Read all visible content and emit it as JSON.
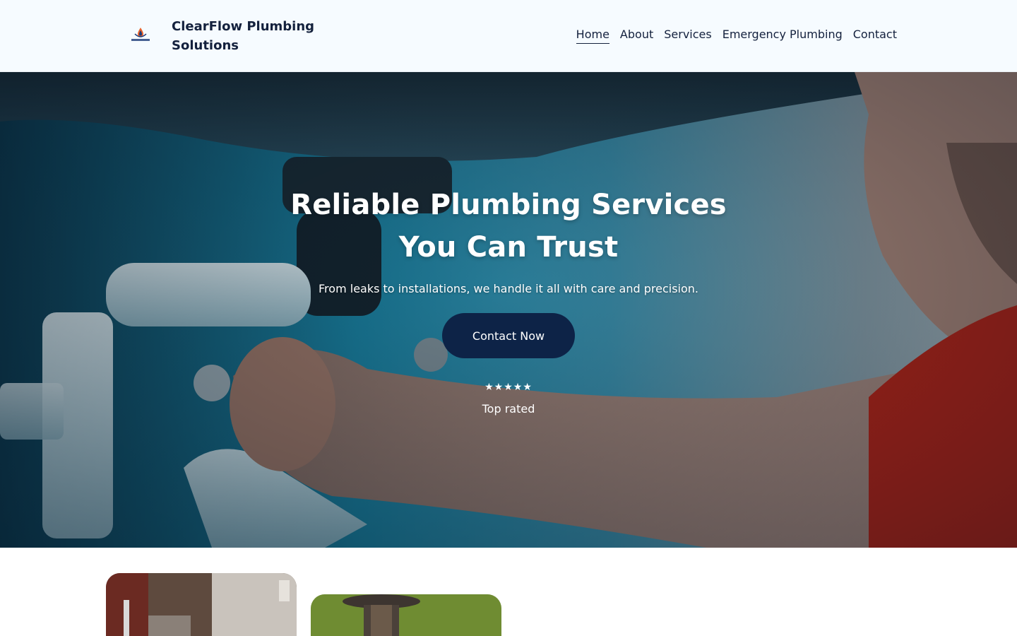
{
  "header": {
    "brand": "ClearFlow Plumbing Solutions",
    "logo_icon": "clearflow-drop-logo",
    "nav": [
      {
        "label": "Home",
        "active": true
      },
      {
        "label": "About",
        "active": false
      },
      {
        "label": "Services",
        "active": false
      },
      {
        "label": "Emergency Plumbing",
        "active": false
      },
      {
        "label": "Contact",
        "active": false
      }
    ]
  },
  "hero": {
    "title": "Reliable Plumbing Services You Can Trust",
    "subtitle": "From leaks to installations, we handle it all with care and precision.",
    "cta_label": "Contact Now",
    "stars": "★★★★★",
    "rating_label": "Top rated"
  },
  "colors": {
    "header_bg": "#f6fbff",
    "brand_text": "#14213d",
    "cta_bg": "#0d2347",
    "hero_text": "#ffffff"
  }
}
